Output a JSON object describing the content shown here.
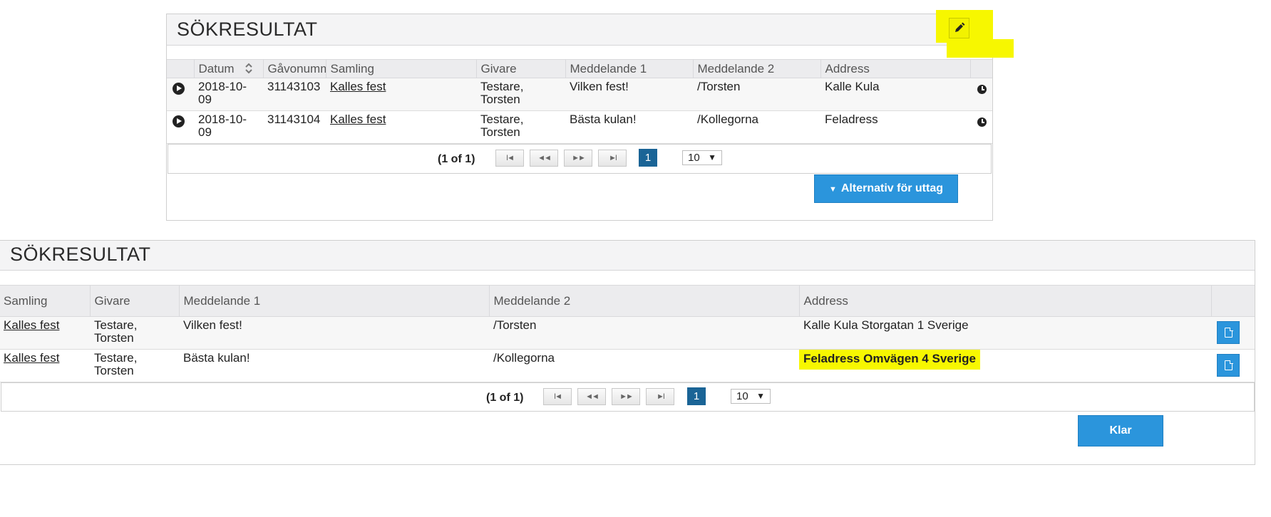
{
  "top_panel": {
    "title": "SÖKRESULTAT",
    "edit_icon": "pencil-icon",
    "columns": [
      "",
      "Datum",
      "Gåvonummer",
      "Samling",
      "Givare",
      "Meddelande 1",
      "Meddelande 2",
      "Address",
      ""
    ],
    "rows": [
      {
        "datum": "2018-10-09",
        "gavonummer": "31143103",
        "samling": "Kalles fest",
        "givare": "Testare, Torsten",
        "meddelande1": "Vilken fest!",
        "meddelande2": "/Torsten",
        "address": "Kalle Kula"
      },
      {
        "datum": "2018-10-09",
        "gavonummer": "31143104",
        "samling": "Kalles fest",
        "givare": "Testare, Torsten",
        "meddelande1": "Bästa kulan!",
        "meddelande2": "/Kollegorna",
        "address": "Feladress"
      }
    ],
    "pager": {
      "status": "(1 of 1)",
      "first": "I◄",
      "prev": "◄◄",
      "next": "►►",
      "last": "►I",
      "current_page": "1",
      "per_page": "10",
      "caret": "▼"
    },
    "action_button": "Alternativ för uttag",
    "action_caret": "▼"
  },
  "bottom_panel": {
    "title": "SÖKRESULTAT",
    "columns": [
      "Samling",
      "Givare",
      "Meddelande 1",
      "Meddelande 2",
      "Address",
      ""
    ],
    "rows": [
      {
        "samling": "Kalles fest",
        "givare": "Testare, Torsten",
        "meddelande1": "Vilken fest!",
        "meddelande2": "/Torsten",
        "address": "Kalle Kula Storgatan 1 Sverige"
      },
      {
        "samling": "Kalles fest",
        "givare": "Testare, Torsten",
        "meddelande1": "Bästa kulan!",
        "meddelande2": "/Kollegorna",
        "address": "Feladress Omvägen 4 Sverige"
      }
    ],
    "pager": {
      "status": "(1 of 1)",
      "first": "I◄",
      "prev": "◄◄",
      "next": "►►",
      "last": "►I",
      "current_page": "1",
      "per_page": "10",
      "caret": "▼"
    },
    "done_button": "Klar"
  },
  "colors": {
    "accent": "#2b95dc",
    "page_active": "#1a6496",
    "highlight": "#f7f700"
  }
}
